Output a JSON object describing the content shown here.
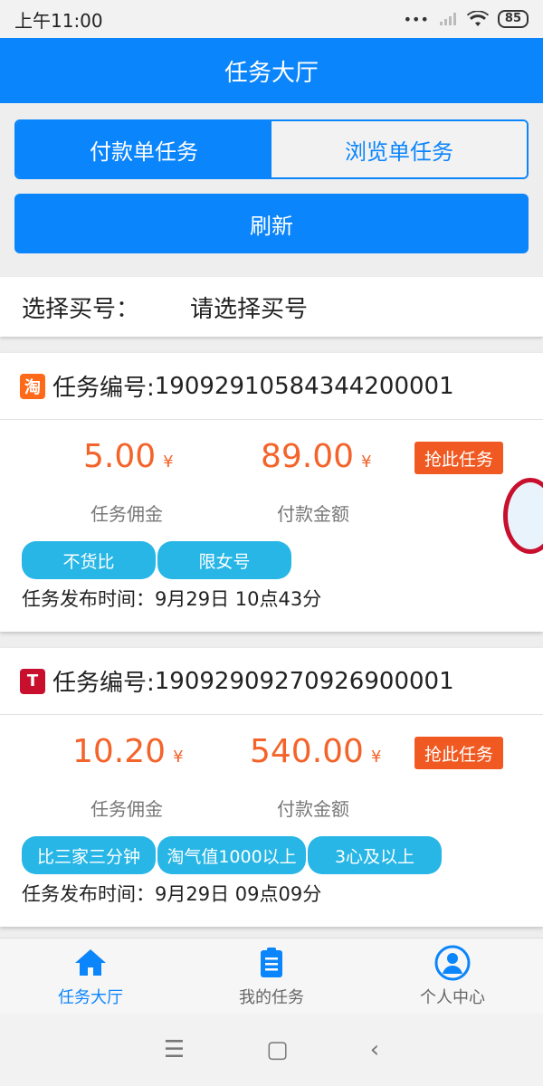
{
  "status_bar": {
    "time": "上午11:00",
    "battery": "85",
    "signal_dots": "•••"
  },
  "header": {
    "title": "任务大厅"
  },
  "tabs": [
    {
      "label": "付款单任务",
      "active": true
    },
    {
      "label": "浏览单任务",
      "active": false
    }
  ],
  "refresh_label": "刷新",
  "account": {
    "label": "选择买号：",
    "placeholder": "请选择买号"
  },
  "tasks": [
    {
      "platform_icon": "taobao-icon",
      "platform_glyph": "淘",
      "id_label": "任务编号:",
      "id": "19092910584344200001",
      "commission": "5.00",
      "amount": "89.00",
      "currency": "¥",
      "commission_label": "任务佣金",
      "amount_label": "付款金额",
      "grab_label": "抢此任务",
      "tags": [
        "不货比",
        "限女号"
      ],
      "publish_label": "任务发布时间：",
      "publish_time": "9月29日 10点43分"
    },
    {
      "platform_icon": "tmall-icon",
      "platform_glyph": "T",
      "id_label": "任务编号:",
      "id": "19092909270926900001",
      "commission": "10.20",
      "amount": "540.00",
      "currency": "¥",
      "commission_label": "任务佣金",
      "amount_label": "付款金额",
      "grab_label": "抢此任务",
      "tags": [
        "比三家三分钟",
        "淘气值1000以上",
        "3心及以上"
      ],
      "publish_label": "任务发布时间：",
      "publish_time": "9月29日 09点09分"
    }
  ],
  "bottom_nav": [
    {
      "label": "任务大厅",
      "icon": "home-icon",
      "active": true
    },
    {
      "label": "我的任务",
      "icon": "clipboard-icon",
      "active": false
    },
    {
      "label": "个人中心",
      "icon": "user-icon",
      "active": false
    }
  ],
  "colors": {
    "primary": "#0b85fb",
    "accent": "#f4632a",
    "tag": "#27b6e6"
  }
}
